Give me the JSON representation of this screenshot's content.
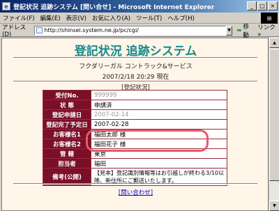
{
  "window": {
    "title": "登記状況 追跡システム [問い合せ] - Microsoft Internet Explorer",
    "buttons": {
      "minimize": "_",
      "maximize": "□",
      "close": "×"
    }
  },
  "menu": [
    "ファイル(F)",
    "編集(E)",
    "表示(V)",
    "お気に入り(A)",
    "ツール(T)",
    "ヘルプ(H)"
  ],
  "address": {
    "label": "アドレス(D)",
    "url": "http://shinsei.system.ne.jp/pc/cgi/",
    "go": "移動",
    "links": "リンク »"
  },
  "page": {
    "title": "登記状況 追跡システム",
    "company": "フクダリーガル コントラック&サービス",
    "datetime": "2007/2/18 20:29 現在",
    "section": "[登記状況]",
    "rows": [
      {
        "label": "受付No.",
        "value": "999999",
        "muted": true
      },
      {
        "label": "状 態",
        "value": "申請済"
      },
      {
        "label": "登記申請日",
        "value": "2007-02-14",
        "muted": true
      },
      {
        "label": "登記完了予定日",
        "value": "2007-02-28"
      },
      {
        "label": "お客様名1",
        "value": "福田太郎 様"
      },
      {
        "label": "お客様名2",
        "value": "福田花子 様"
      },
      {
        "label": "管 轄",
        "value": "東京"
      },
      {
        "label": "担当者",
        "value": "福田"
      },
      {
        "label": "備考(公開)",
        "value": "【見本】登記識別情報等はお引越しが終わる3/10以降、新住所にご郵送いたします。"
      }
    ],
    "inquiry_link": "[問い合わせ]"
  },
  "colors": {
    "title_teal": "#138a8a",
    "table_header": "#7a0f28",
    "highlight": "#e85a6a",
    "page_bg": "#fff5e8"
  }
}
